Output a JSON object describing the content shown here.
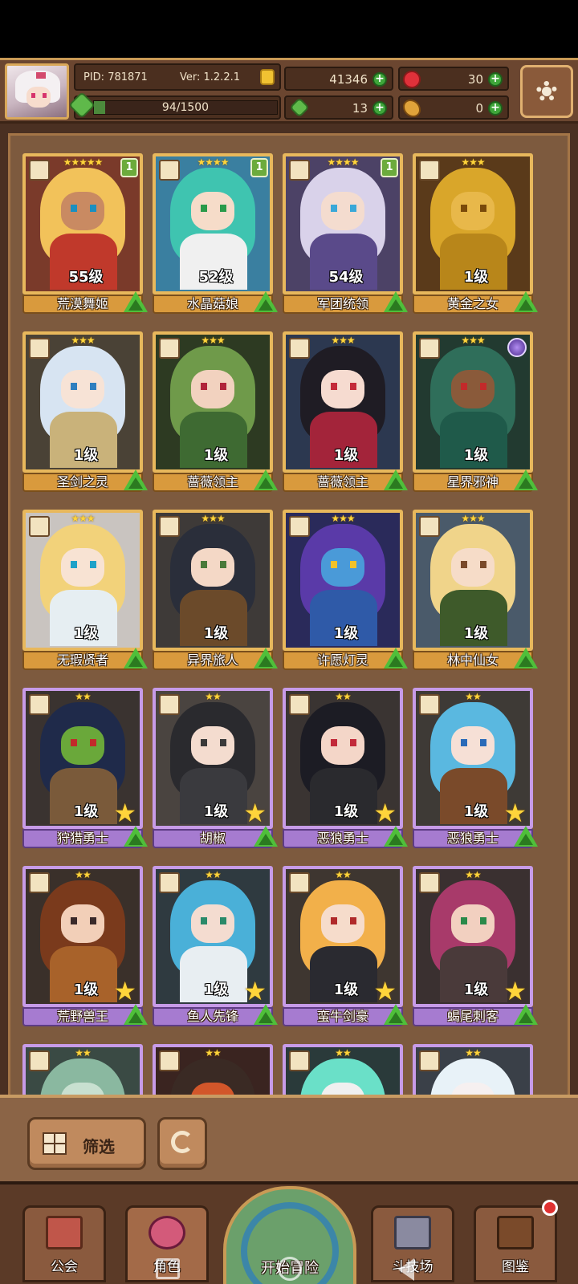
{
  "player": {
    "pid_label": "PID: 781871",
    "version_label": "Ver: 1.2.2.1",
    "stamina": "94/1500",
    "stamina_fraction": 0.0627
  },
  "resources": {
    "gold": "41346",
    "gems": "30",
    "clover": "13",
    "bread": "0"
  },
  "colors": {
    "gold_frame": "#e8b85c",
    "purple_frame": "#c79be8",
    "panel_brown": "#4b2f1f",
    "upgrade_green": "#4fbf3a"
  },
  "characters": [
    {
      "name": "荒漠舞姬",
      "level": "55级",
      "stars": "★★★★★",
      "badge": "1",
      "rarity": "gold",
      "hair": "#f2c25a",
      "skin": "#c98a62",
      "outfit": "#c0392b",
      "bg": "#7a3a2a",
      "eye": "#1b8fbf"
    },
    {
      "name": "水晶菇娘",
      "level": "52级",
      "stars": "★★★★",
      "badge": "1",
      "rarity": "gold",
      "hair": "#3fc4b0",
      "skin": "#f6dcc9",
      "outfit": "#f0f0f0",
      "bg": "#3a7fa0",
      "eye": "#2a9a4a"
    },
    {
      "name": "军团统领",
      "level": "54级",
      "stars": "★★★★",
      "badge": "1",
      "rarity": "gold",
      "hair": "#d9d2ea",
      "skin": "#f4dccf",
      "outfit": "#5a4a8a",
      "bg": "#4c4266",
      "eye": "#3aa8d8"
    },
    {
      "name": "黄金之女",
      "level": "1级",
      "stars": "★★★",
      "badge": "",
      "rarity": "gold",
      "hair": "#d9a62a",
      "skin": "#e8b84a",
      "outfit": "#b8861a",
      "bg": "#5a3a1a",
      "eye": "#7a4a0a"
    },
    {
      "name": "圣剑之灵",
      "level": "1级",
      "stars": "★★★",
      "badge": "",
      "rarity": "gold",
      "hair": "#d7e4f2",
      "skin": "#f7e3d6",
      "outfit": "#c9b27a",
      "bg": "#4a4236",
      "eye": "#2f7fbf"
    },
    {
      "name": "蔷薇领主",
      "level": "1级",
      "stars": "★★★",
      "badge": "",
      "rarity": "gold",
      "hair": "#6f9a4a",
      "skin": "#f2d2bf",
      "outfit": "#3e6a32",
      "bg": "#2d3a22",
      "eye": "#b0243a"
    },
    {
      "name": "蔷薇领主",
      "level": "1级",
      "stars": "★★★",
      "badge": "",
      "rarity": "gold",
      "hair": "#1f1c24",
      "skin": "#f6dbd0",
      "outfit": "#a3243a",
      "bg": "#2c3850",
      "eye": "#c42a3a"
    },
    {
      "name": "星界邪神",
      "level": "1级",
      "stars": "★★★",
      "badge": "",
      "orb": true,
      "rarity": "gold",
      "hair": "#2f6e5a",
      "skin": "#8a5a3a",
      "outfit": "#1f5a4a",
      "bg": "#223a30",
      "eye": "#c22a2a"
    },
    {
      "name": "无瑕贤者",
      "level": "1级",
      "stars": "★★★",
      "badge": "",
      "rarity": "gold",
      "hair": "#f2d27a",
      "skin": "#f8e3d3",
      "outfit": "#e6eef2",
      "bg": "#c9c4c0",
      "eye": "#1fa2c8"
    },
    {
      "name": "异界旅人",
      "level": "1级",
      "stars": "★★★",
      "badge": "",
      "rarity": "gold",
      "hair": "#2a2e3a",
      "skin": "#f4d8c6",
      "outfit": "#6b4a2a",
      "bg": "#3e3a38",
      "eye": "#4a7a3a"
    },
    {
      "name": "许愿灯灵",
      "level": "1级",
      "stars": "★★★",
      "badge": "",
      "rarity": "gold",
      "hair": "#5a3aa8",
      "skin": "#4a9ad8",
      "outfit": "#2f5aa8",
      "bg": "#2a2a5a",
      "eye": "#f2c22a"
    },
    {
      "name": "林中仙女",
      "level": "1级",
      "stars": "★★★",
      "badge": "",
      "rarity": "gold",
      "hair": "#f0d48a",
      "skin": "#f6dcc8",
      "outfit": "#3e5a2a",
      "bg": "#4a5a6a",
      "eye": "#7a4a2a"
    },
    {
      "name": "狩猎勇士",
      "level": "1级",
      "stars": "★★",
      "badge": "",
      "rarity": "purple",
      "hair": "#1f2a4a",
      "skin": "#6aa83a",
      "outfit": "#7a5a3a",
      "bg": "#3a3330",
      "eye": "#c22a2a"
    },
    {
      "name": "胡椒",
      "level": "1级",
      "stars": "★★",
      "badge": "",
      "rarity": "purple",
      "hair": "#2a2a2e",
      "skin": "#f4dccf",
      "outfit": "#3a3a3e",
      "bg": "#4a4440",
      "eye": "#3a3a3a"
    },
    {
      "name": "恶狼勇士",
      "level": "1级",
      "stars": "★★",
      "badge": "",
      "rarity": "purple",
      "hair": "#1c1c24",
      "skin": "#f4d6c8",
      "outfit": "#2a2a2e",
      "bg": "#3a3432",
      "eye": "#c22a3a"
    },
    {
      "name": "恶狼勇士",
      "level": "1级",
      "stars": "★★",
      "badge": "",
      "rarity": "purple",
      "hair": "#5ab8e0",
      "skin": "#f6e0d6",
      "outfit": "#7a4a2a",
      "bg": "#3e3a36",
      "eye": "#2a6ab8"
    },
    {
      "name": "荒野兽王",
      "level": "1级",
      "stars": "★★",
      "badge": "",
      "rarity": "purple",
      "hair": "#7a3a1c",
      "skin": "#f2cfb8",
      "outfit": "#a8622a",
      "bg": "#3a302a",
      "eye": "#3a2a2a"
    },
    {
      "name": "鱼人先锋",
      "level": "1级",
      "stars": "★★",
      "badge": "",
      "rarity": "purple",
      "hair": "#4ab0d8",
      "skin": "#f4dcd0",
      "outfit": "#e8eef2",
      "bg": "#2f3a40",
      "eye": "#2a8a6a"
    },
    {
      "name": "蛮牛剑豪",
      "level": "1级",
      "stars": "★★",
      "badge": "",
      "rarity": "purple",
      "hair": "#f2b04a",
      "skin": "#f6dccb",
      "outfit": "#2a2a30",
      "bg": "#3e3630",
      "eye": "#b02a2a"
    },
    {
      "name": "蝎尾刺客",
      "level": "1级",
      "stars": "★★",
      "badge": "",
      "rarity": "purple",
      "hair": "#a83a6a",
      "skin": "#f2d0c0",
      "outfit": "#4a3a3a",
      "bg": "#3a3030",
      "eye": "#2a8a4a"
    },
    {
      "name": "",
      "level": "",
      "stars": "★★",
      "badge": "",
      "rarity": "purple",
      "hair": "#8ab8a0",
      "skin": "#c8e0d0",
      "outfit": "#5a7a6a",
      "bg": "#3a4a44",
      "eye": "#2a2a2a"
    },
    {
      "name": "",
      "level": "",
      "stars": "★★",
      "badge": "",
      "rarity": "purple",
      "hair": "#3a2a24",
      "skin": "#d2562a",
      "outfit": "#5a2a1a",
      "bg": "#3a2420",
      "eye": "#f2a02a"
    },
    {
      "name": "",
      "level": "",
      "stars": "★★",
      "badge": "",
      "rarity": "purple",
      "hair": "#6ae0c8",
      "skin": "#f0f0f0",
      "outfit": "#4ab8a8",
      "bg": "#2a3a3a",
      "eye": "#2a2a2a"
    },
    {
      "name": "",
      "level": "",
      "stars": "★★",
      "badge": "",
      "rarity": "purple",
      "hair": "#e8f2f8",
      "skin": "#f6f0f0",
      "outfit": "#a8c8e0",
      "bg": "#3a4048",
      "eye": "#2a2a2a"
    }
  ],
  "controls": {
    "filter_label": "筛选"
  },
  "nav": {
    "guild": "公会",
    "characters": "角色",
    "adventure": "开始冒险",
    "arena": "斗技场",
    "codex": "图鉴"
  }
}
